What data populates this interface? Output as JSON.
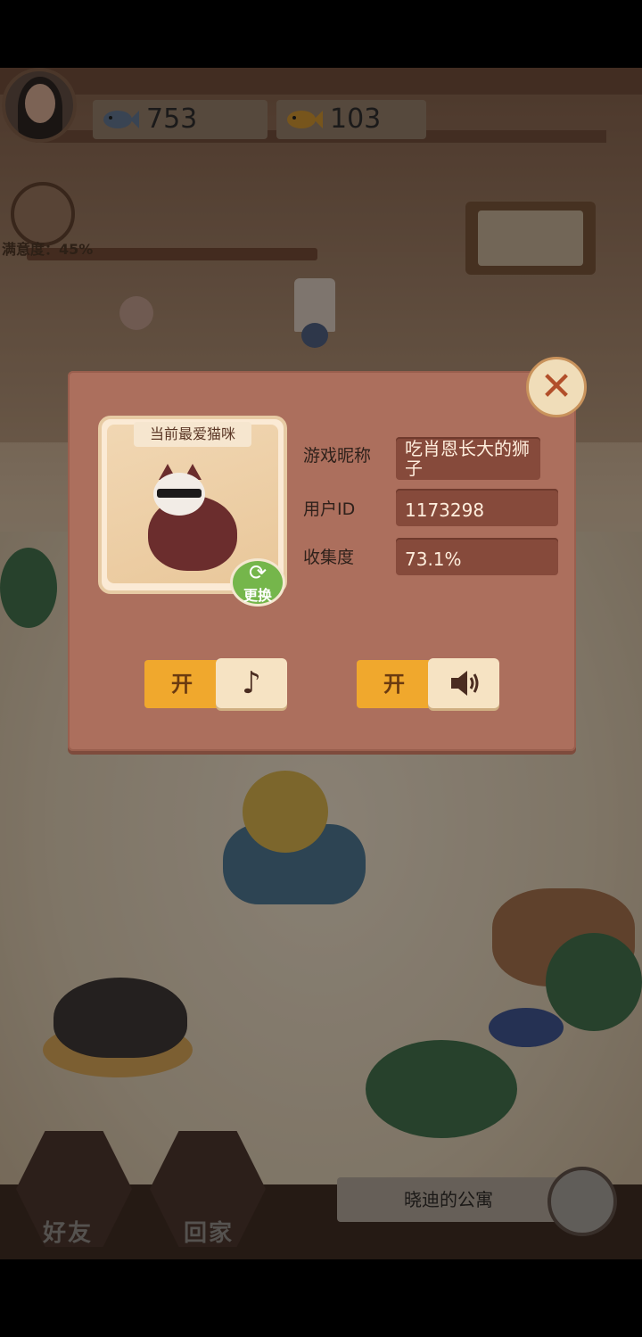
{
  "hud": {
    "fish_blue": "753",
    "fish_gold": "103",
    "satisfaction_label": "满意度：45%"
  },
  "profile_dialog": {
    "favorite_cat_title": "当前最爱猫咪",
    "swap_label": "更换",
    "fields": {
      "nickname_label": "游戏昵称",
      "nickname_value": "吃肖恩长大的狮子",
      "user_id_label": "用户ID",
      "user_id_value": "1173298",
      "collection_label": "收集度",
      "collection_value": "73.1%"
    },
    "music_toggle": {
      "state_label": "开",
      "icon": "music-note-icon"
    },
    "sound_toggle": {
      "state_label": "开",
      "icon": "speaker-icon"
    }
  },
  "bottom_nav": {
    "friends_label": "好友",
    "home_label": "回家",
    "apartment_label": "晓迪的公寓"
  },
  "colors": {
    "dialog_bg": "#ac6f5d",
    "field_bg": "#864a3b",
    "toggle_on": "#f0a82d",
    "swap_green": "#75b64b",
    "close_red": "#b24f2a"
  }
}
